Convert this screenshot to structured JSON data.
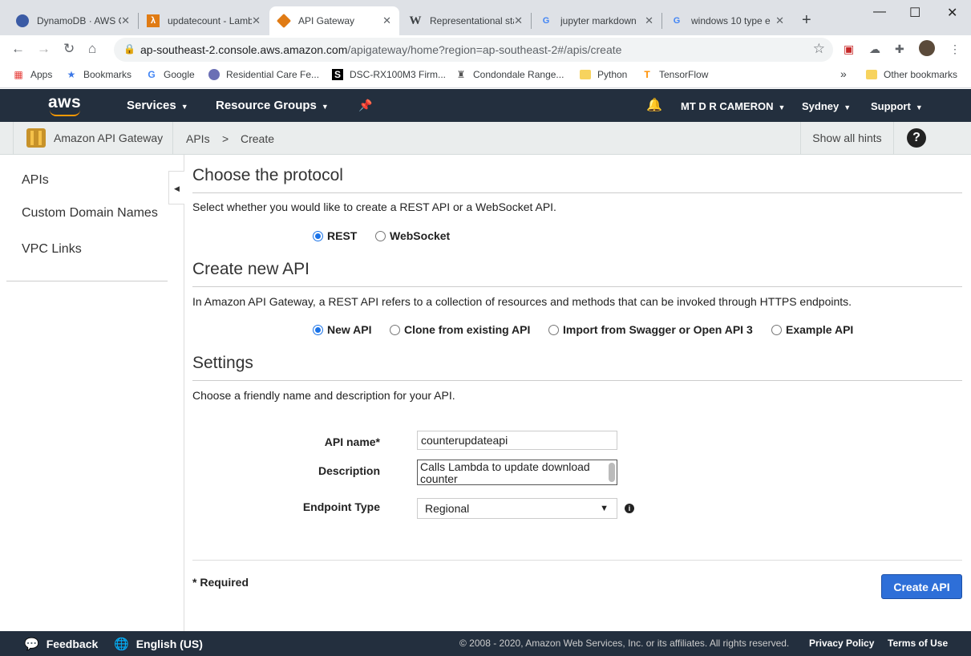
{
  "browser": {
    "tabs": [
      {
        "label": "DynamoDB · AWS Console",
        "icon": "dynamodb-icon"
      },
      {
        "label": "updatecount - Lambda",
        "icon": "lambda-icon"
      },
      {
        "label": "API Gateway",
        "icon": "api-gateway-icon"
      },
      {
        "label": "Representational state",
        "icon": "wikipedia-icon"
      },
      {
        "label": "jupyter markdown",
        "icon": "google-icon"
      },
      {
        "label": "windows 10 type e",
        "icon": "google-icon"
      }
    ],
    "url_host": "ap-southeast-2.console.aws.amazon.com",
    "url_path": "/apigateway/home?region=ap-southeast-2#/apis/create",
    "bookmarks": [
      "Apps",
      "Bookmarks",
      "Google",
      "Residential Care Fe...",
      "DSC-RX100M3 Firm...",
      "Condondale Range...",
      "Python",
      "TensorFlow"
    ],
    "other_bookmarks": "Other bookmarks",
    "overflow": "»"
  },
  "aws_nav": {
    "logo": "aws",
    "services": "Services",
    "resource_groups": "Resource Groups",
    "user": "MT D R CAMERON",
    "region": "Sydney",
    "support": "Support"
  },
  "subbar": {
    "service_name": "Amazon API Gateway",
    "crumb_apis": "APIs",
    "crumb_sep": ">",
    "crumb_create": "Create",
    "show_hints": "Show all hints",
    "help": "?"
  },
  "leftnav": {
    "items": [
      "APIs",
      "Custom Domain Names",
      "VPC Links"
    ]
  },
  "protocol": {
    "title": "Choose the protocol",
    "desc": "Select whether you would like to create a REST API or a WebSocket API.",
    "options": [
      "REST",
      "WebSocket"
    ],
    "selected": "REST"
  },
  "create_api": {
    "title": "Create new API",
    "desc": "In Amazon API Gateway, a REST API refers to a collection of resources and methods that can be invoked through HTTPS endpoints.",
    "options": [
      "New API",
      "Clone from existing API",
      "Import from Swagger or Open API 3",
      "Example API"
    ],
    "selected": "New API"
  },
  "settings": {
    "title": "Settings",
    "desc": "Choose a friendly name and description for your API.",
    "api_name_label": "API name*",
    "api_name_value": "counterupdateapi",
    "description_label": "Description",
    "description_value": "Calls Lambda to update download counter",
    "endpoint_label": "Endpoint Type",
    "endpoint_value": "Regional"
  },
  "form_footer": {
    "required": "* Required",
    "create_button": "Create API"
  },
  "footer": {
    "feedback": "Feedback",
    "language": "English (US)",
    "copyright": "© 2008 - 2020, Amazon Web Services, Inc. or its affiliates. All rights reserved.",
    "privacy": "Privacy Policy",
    "terms": "Terms of Use"
  }
}
